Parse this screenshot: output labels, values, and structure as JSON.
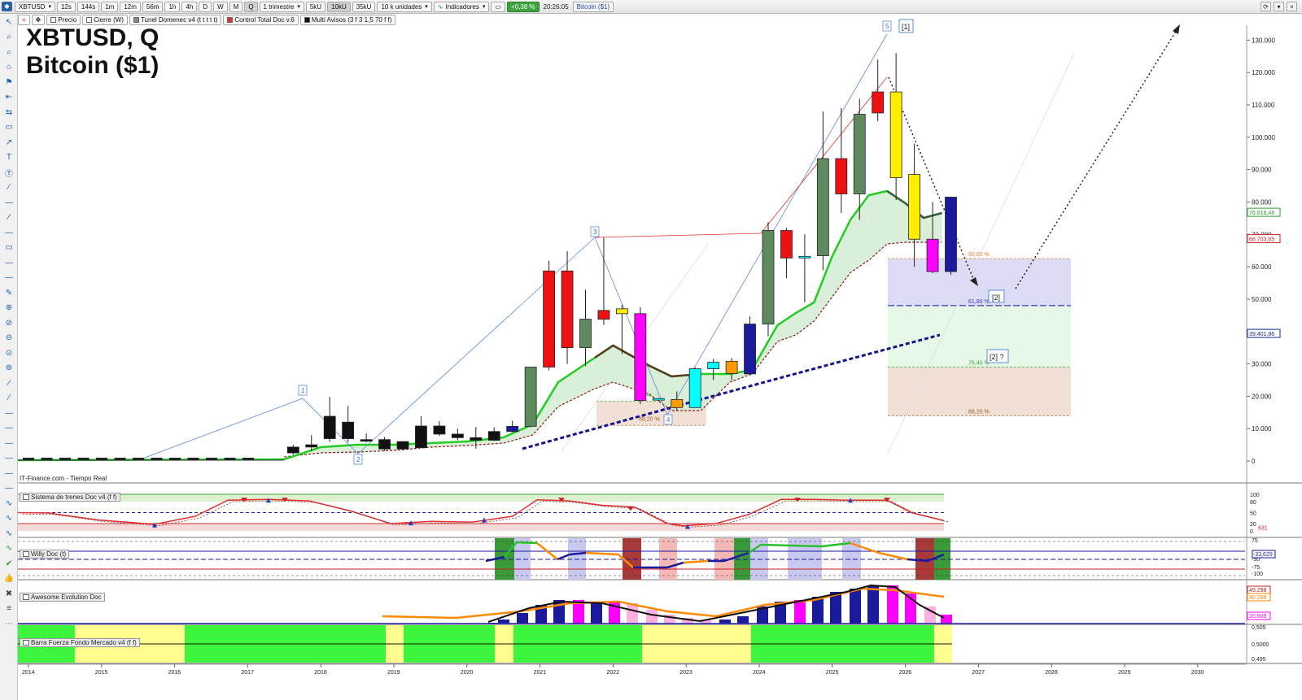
{
  "toolbar": {
    "symbol": "XBTUSD",
    "intervals": [
      "12s",
      "144s",
      "1m",
      "12m",
      "56m",
      "1h",
      "4h",
      "D",
      "W",
      "M",
      "Q"
    ],
    "period": "1 trimestre",
    "units": [
      "5kU",
      "10kU",
      "35kU"
    ],
    "units_count": "10 k unidades",
    "indicators": "Indicadores",
    "change": "+0,38 %",
    "time": "20:26:05",
    "instrument_name": "Bitcoin ($1)"
  },
  "legend": [
    "Precio",
    "Cierre (W)",
    "Tunel Domenec v4 (t t t t t)",
    "Control Total Doc v.6",
    "Multi Avisos (3 f 3 1,5 70 f f)"
  ],
  "title": {
    "line1": "XBTUSD, Q",
    "line2": "Bitcoin ($1)"
  },
  "source_label": "IT-Finance.com - Tiempo Real",
  "panels": {
    "trend": "Sistema de trenes Doc v4 (f f)",
    "willy": "Willy Doc (t)",
    "awesome": "Awesome Evolution Doc",
    "bar": "Barra Fuerza Fondo Mercado v4 (f f)"
  },
  "price_axis": {
    "ticks": [
      "130.000",
      "120.000",
      "110.000",
      "100.000",
      "90.000",
      "80.000",
      "70.000",
      "60.000",
      "50.000",
      "40.000",
      "30.000",
      "20.000",
      "10.000",
      "0"
    ],
    "flags": [
      {
        "text": "76.818,48",
        "color": "#2e9a2e",
        "value": 76818
      },
      {
        "text": "68.703,65",
        "color": "#cc2222",
        "value": 68703
      },
      {
        "text": "39.401,86",
        "color": "#1b2b9a",
        "value": 39401
      }
    ]
  },
  "trend_axis": {
    "ticks": [
      "100",
      "80",
      "50",
      "20",
      "0"
    ],
    "flag": "631"
  },
  "willy_axis": {
    "ticks": [
      "75",
      "-25",
      "-50",
      "-75",
      "-100"
    ],
    "flag": "-33,629"
  },
  "awesome_axis": {
    "flags": [
      "49.298",
      "46.298",
      "20.609"
    ]
  },
  "bar_axis": {
    "ticks": [
      "0,505",
      "0,5000",
      "0,495"
    ]
  },
  "years": [
    "2014",
    "2015",
    "2016",
    "2017",
    "2018",
    "2019",
    "2020",
    "2021",
    "2022",
    "2023",
    "2024",
    "2025",
    "2026",
    "2027",
    "2028",
    "2029",
    "2030"
  ],
  "fib_levels": [
    {
      "label": "50,00 %",
      "color": "#e07b2e"
    },
    {
      "label": "61,80 %",
      "color": "#3a3ac8"
    },
    {
      "label": "76,40 %",
      "color": "#3aa83a"
    },
    {
      "label": "88,20 %",
      "color": "#a0622a"
    }
  ],
  "fib_small": [
    {
      "label": "76,40 %"
    },
    {
      "label": "88,20 %"
    }
  ],
  "wave_labels": [
    "1",
    "2",
    "3",
    "4",
    "5"
  ],
  "annotations": [
    "[1]",
    "[2]",
    "[2] ?"
  ],
  "chart_data": {
    "type": "candlestick",
    "title": "XBTUSD, Q",
    "subtitle": "Bitcoin ($1)",
    "ylim": [
      0,
      130000
    ],
    "colors": {
      "black": "#111111",
      "red": "#ee1111",
      "green": "#5f8a5f",
      "yellow": "#ffee00",
      "magenta": "#ff00ff",
      "blue": "#1a1a9a",
      "cyan": "#00ffff",
      "orange": "#ff9a00"
    },
    "candles": [
      {
        "t": "2017Q3",
        "o": 2500,
        "h": 5000,
        "l": 1900,
        "c": 4300,
        "col": "black"
      },
      {
        "t": "2017Q4",
        "o": 4300,
        "h": 8000,
        "l": 3000,
        "c": 5000,
        "col": "black"
      },
      {
        "t": "2018Q1",
        "o": 13800,
        "h": 19800,
        "l": 5900,
        "c": 6900,
        "col": "black"
      },
      {
        "t": "2018Q2",
        "o": 6900,
        "h": 17000,
        "l": 5800,
        "c": 12000,
        "col": "black"
      },
      {
        "t": "2018Q3",
        "o": 6400,
        "h": 8500,
        "l": 5800,
        "c": 6600,
        "col": "black"
      },
      {
        "t": "2018Q4",
        "o": 6600,
        "h": 7400,
        "l": 3100,
        "c": 3700,
        "col": "black"
      },
      {
        "t": "2019Q1",
        "o": 3700,
        "h": 5000,
        "l": 3300,
        "c": 6000,
        "col": "black"
      },
      {
        "t": "2019Q2",
        "o": 4100,
        "h": 13800,
        "l": 4100,
        "c": 10800,
        "col": "black"
      },
      {
        "t": "2019Q3",
        "o": 10800,
        "h": 12300,
        "l": 7700,
        "c": 8300,
        "col": "black"
      },
      {
        "t": "2019Q4",
        "o": 8300,
        "h": 10000,
        "l": 6400,
        "c": 7200,
        "col": "black"
      },
      {
        "t": "2020Q1",
        "o": 7200,
        "h": 10500,
        "l": 3800,
        "c": 6400,
        "col": "black"
      },
      {
        "t": "2020Q2",
        "o": 6400,
        "h": 10400,
        "l": 6200,
        "c": 9100,
        "col": "black"
      },
      {
        "t": "2020Q3",
        "o": 9100,
        "h": 12400,
        "l": 8900,
        "c": 10700,
        "col": "blue"
      },
      {
        "t": "2020Q4",
        "o": 10700,
        "h": 29000,
        "l": 10400,
        "c": 29000,
        "col": "green"
      },
      {
        "t": "2021Q1",
        "o": 58700,
        "h": 61800,
        "l": 28000,
        "c": 29000,
        "col": "red"
      },
      {
        "t": "2021Q2",
        "o": 58700,
        "h": 64800,
        "l": 30000,
        "c": 35000,
        "col": "red"
      },
      {
        "t": "2021Q3",
        "o": 35000,
        "h": 52900,
        "l": 29300,
        "c": 43800,
        "col": "green"
      },
      {
        "t": "2021Q4",
        "o": 46500,
        "h": 69000,
        "l": 42000,
        "c": 43800,
        "col": "red"
      },
      {
        "t": "2022Q1",
        "o": 47000,
        "h": 48200,
        "l": 33000,
        "c": 45500,
        "col": "yellow"
      },
      {
        "t": "2022Q2",
        "o": 45500,
        "h": 47500,
        "l": 17600,
        "c": 18700,
        "col": "magenta"
      },
      {
        "t": "2022Q3",
        "o": 19000,
        "h": 19500,
        "l": 18500,
        "c": 19300,
        "col": "cyan"
      },
      {
        "t": "2022Q4",
        "o": 19000,
        "h": 21500,
        "l": 15500,
        "c": 16500,
        "col": "orange"
      },
      {
        "t": "2023Q1",
        "o": 16500,
        "h": 28900,
        "l": 16500,
        "c": 28500,
        "col": "cyan"
      },
      {
        "t": "2023Q2",
        "o": 28500,
        "h": 31500,
        "l": 25000,
        "c": 30500,
        "col": "cyan"
      },
      {
        "t": "2023Q3",
        "o": 27000,
        "h": 31800,
        "l": 24900,
        "c": 30800,
        "col": "orange"
      },
      {
        "t": "2023Q4",
        "o": 26900,
        "h": 44700,
        "l": 26500,
        "c": 42300,
        "col": "blue"
      },
      {
        "t": "2024Q1",
        "o": 42300,
        "h": 73800,
        "l": 38500,
        "c": 71200,
        "col": "green"
      },
      {
        "t": "2024Q2",
        "o": 71200,
        "h": 72000,
        "l": 56500,
        "c": 62700,
        "col": "red"
      },
      {
        "t": "2024Q3",
        "o": 63200,
        "h": 70000,
        "l": 49000,
        "c": 62700,
        "col": "cyan"
      },
      {
        "t": "2024Q4",
        "o": 63400,
        "h": 108000,
        "l": 58900,
        "c": 93400,
        "col": "green"
      },
      {
        "t": "2025Q1",
        "o": 93400,
        "h": 109000,
        "l": 76600,
        "c": 82500,
        "col": "red"
      },
      {
        "t": "2025Q2",
        "o": 82500,
        "h": 111900,
        "l": 74500,
        "c": 107100,
        "col": "green"
      },
      {
        "t": "2025Q3",
        "o": 114000,
        "h": 124000,
        "l": 105000,
        "c": 107500,
        "col": "red"
      },
      {
        "t": "2025Q4",
        "o": 114000,
        "h": 126000,
        "l": 80600,
        "c": 87500,
        "col": "yellow"
      },
      {
        "t": "2026Q1",
        "o": 88500,
        "h": 98000,
        "l": 60000,
        "c": 68500,
        "col": "yellow"
      },
      {
        "t": "2026Q2",
        "o": 68500,
        "h": 80000,
        "l": 58000,
        "c": 58500,
        "col": "magenta"
      },
      {
        "t": "2026Q3",
        "o": 58500,
        "h": 81000,
        "l": 57500,
        "c": 81500,
        "col": "blue"
      }
    ]
  }
}
